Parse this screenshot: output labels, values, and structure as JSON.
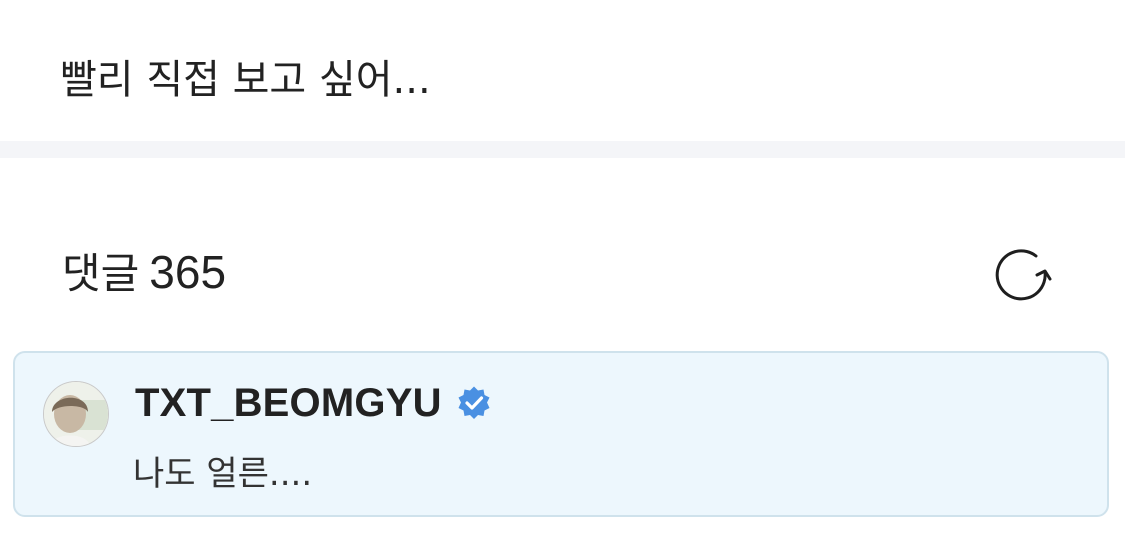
{
  "post": {
    "text": "빨리 직접 보고 싶어..."
  },
  "comments": {
    "label": "댓글",
    "count": "365",
    "refresh_icon": "refresh-icon",
    "items": [
      {
        "author": "TXT_BEOMGYU",
        "verified": true,
        "verified_icon": "verified-badge-icon",
        "avatar_icon": "avatar",
        "text": "나도 얼른...."
      }
    ]
  },
  "colors": {
    "highlight_bg": "#edf7fd",
    "highlight_border": "#cfe2ec",
    "verified_blue": "#4a90e2",
    "divider": "#f4f5f8",
    "text": "#222222"
  }
}
